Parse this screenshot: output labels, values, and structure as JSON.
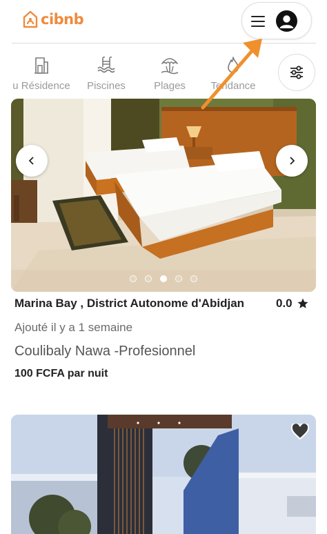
{
  "header": {
    "brand": "cibnb",
    "brand_color": "#f08a3c",
    "menu_icon": "hamburger-icon",
    "avatar_icon": "user-avatar-icon"
  },
  "categories": [
    {
      "label": "u Résidence",
      "icon": "building-icon"
    },
    {
      "label": "Piscines",
      "icon": "pool-icon"
    },
    {
      "label": "Plages",
      "icon": "beach-umbrella-icon"
    },
    {
      "label": "Tendance",
      "icon": "flame-icon"
    }
  ],
  "filters_icon": "sliders-icon",
  "listing": {
    "title": "Marina Bay , District Autonome d'Abidjan",
    "rating": "0.0",
    "added": "Ajouté il y a 1 semaine",
    "host": "Coulibaly Nawa -Profesionnel",
    "price": "100 FCFA par nuit",
    "carousel_total": 5,
    "carousel_active": 3
  },
  "accent_color": "#f08a3c"
}
